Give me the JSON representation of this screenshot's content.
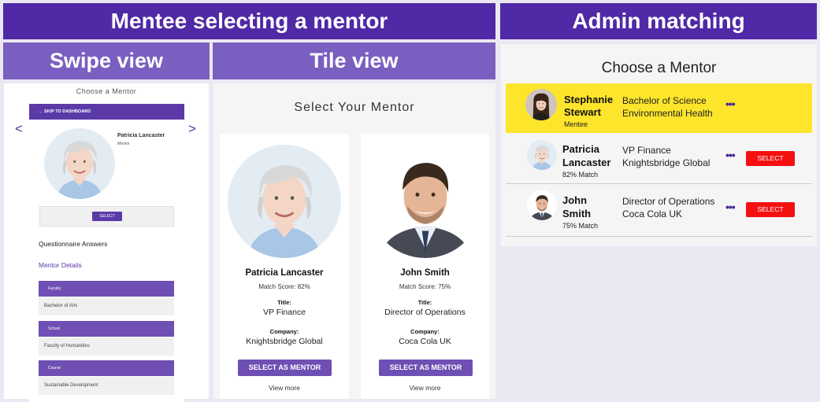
{
  "banners": {
    "mentee": "Mentee selecting a mentor",
    "admin": "Admin matching",
    "swipe": "Swipe view",
    "tile": "Tile view"
  },
  "swipe": {
    "title": "Choose a Mentor",
    "nav_prev": "<",
    "nav_next": ">",
    "skip_label": "← SKIP TO DASHBOARD",
    "mentor_name": "Patricia Lancaster",
    "mentor_role": "Mentor",
    "select_label": "SELECT",
    "questionnaire_label": "Questionnaire Answers",
    "mentor_details_label": "Mentor Details",
    "details": [
      {
        "heading": "Faculty",
        "value": "Bachelor of Arts"
      },
      {
        "heading": "School",
        "value": "Faculty of Humanities"
      },
      {
        "heading": "Course",
        "value": "Sustainable Development"
      }
    ]
  },
  "tile": {
    "title": "Select Your Mentor",
    "cards": [
      {
        "name": "Patricia Lancaster",
        "score": "Match Score: 82%",
        "title_label": "Title:",
        "title_value": "VP Finance",
        "company_label": "Company:",
        "company_value": "Knightsbridge Global",
        "button_label": "SELECT AS MENTOR",
        "more_label": "View more"
      },
      {
        "name": "John Smith",
        "score": "Match Score: 75%",
        "title_label": "Title:",
        "title_value": "Director of Operations",
        "company_label": "Company:",
        "company_value": "Coca Cola UK",
        "button_label": "SELECT AS MENTOR",
        "more_label": "View more"
      }
    ]
  },
  "admin": {
    "title": "Choose a Mentor",
    "mentee": {
      "name_line1": "Stephanie",
      "name_line2": "Stewart",
      "sub": "Mentee",
      "info_line1": "Bachelor of Science",
      "info_line2": "Environmental Health",
      "dots": "•••"
    },
    "mentors": [
      {
        "name_line1": "Patricia",
        "name_line2": "Lancaster",
        "sub": "82% Match",
        "info_line1": "VP Finance",
        "info_line2": "Knightsbridge Global",
        "dots": "•••",
        "select_label": "SELECT"
      },
      {
        "name_line1": "John",
        "name_line2": "Smith",
        "sub": "75% Match",
        "info_line1": "Director of Operations",
        "info_line2": "Coca Cola UK",
        "dots": "•••",
        "select_label": "SELECT"
      }
    ]
  },
  "colors": {
    "banner": "#5029a6",
    "subbanner": "#7b5fc0",
    "accent_purple": "#6f4fb3",
    "highlight_yellow": "#fde52b",
    "select_red": "#f51010"
  }
}
